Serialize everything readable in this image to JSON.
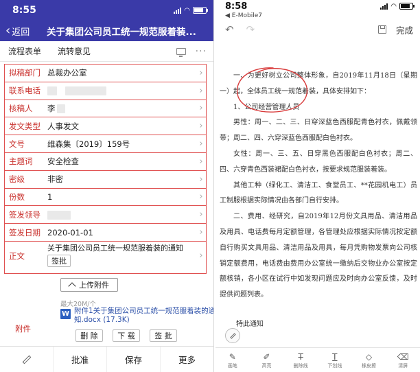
{
  "left": {
    "status": {
      "time": "8:55"
    },
    "nav": {
      "back": "返回",
      "title": "关于集团公司员工统一规范服着装..."
    },
    "tabs": [
      "流程表单",
      "流转意见"
    ],
    "fields": [
      {
        "label": "拟稿部门",
        "value": "总裁办公室"
      },
      {
        "label": "联系电话",
        "value": ""
      },
      {
        "label": "核稿人",
        "value": "李"
      },
      {
        "label": "发文类型",
        "value": "人事发文"
      },
      {
        "label": "文号",
        "value": "维森集〔2019〕159号"
      },
      {
        "label": "主题词",
        "value": "安全检查"
      },
      {
        "label": "密级",
        "value": "非密"
      },
      {
        "label": "份数",
        "value": "1"
      },
      {
        "label": "签发领导",
        "value": ""
      },
      {
        "label": "签发日期",
        "value": "2020-01-01"
      }
    ],
    "zhengwen": {
      "label": "正文",
      "title": "关于集团公司员工统一规范服着装的通知",
      "button": "签批"
    },
    "attachment": {
      "label": "附件",
      "upload": "上传附件",
      "max_hint": "最大20M/个",
      "file_icon": "W",
      "file_name": "附件1关于集团公司员工统一规范服着装的通知.docx (17.3K)",
      "delete": "删 除",
      "download": "下 载",
      "sign": "签 批"
    },
    "bottom": [
      "批准",
      "保存",
      "更多"
    ]
  },
  "right": {
    "status": {
      "time": "8:58",
      "carrier": "◀ E-Mobile7"
    },
    "toolbar": {
      "done": "完成"
    },
    "doc": {
      "paragraphs": [
        "一、为更好树立公司整体形象，自2019年11月18日（星期一）起，全体员工统一规范着装，具体安排如下：",
        "1、公司经营管理人员",
        "男性：周一、二、三、日穿深蓝色西服配青色衬衣，佩戴领带；周二、四、六穿深蓝色西服配白色衬衣。",
        "女性：周一、三、五、日穿黑色西服配白色衬衣；周二、四、六穿青色西装裙配白色衬衣，按要求规范服装着装。",
        "其他工种（绿化工、清洁工、食堂员工、**花园机电工）员工制服根据实际情况由各部门自行安排。",
        "二、费用、经研究，自2019年12月份文具用品、清洁用品及用具、电话费每月定额管理，各管理处应根据实际情况按定额自行购买文具用品、清洁用品及用具，每月凭购物发票向公司核销定额费用，电话费由费用办公室统一缴纳后交物业办公室按定额核销，各小区在试行中如发现问题应及时向办公室反馈，及时提供问题列表。"
      ],
      "sign": "特此通知"
    },
    "bottom": [
      "画笔",
      "高亮",
      "删除线",
      "下划线",
      "橡皮擦",
      "清屏"
    ]
  },
  "colors": {
    "brand": "#3a3aa8",
    "label_red": "#c9302c",
    "link_blue": "#2b4fa8",
    "ink_red": "#d83a3a"
  }
}
